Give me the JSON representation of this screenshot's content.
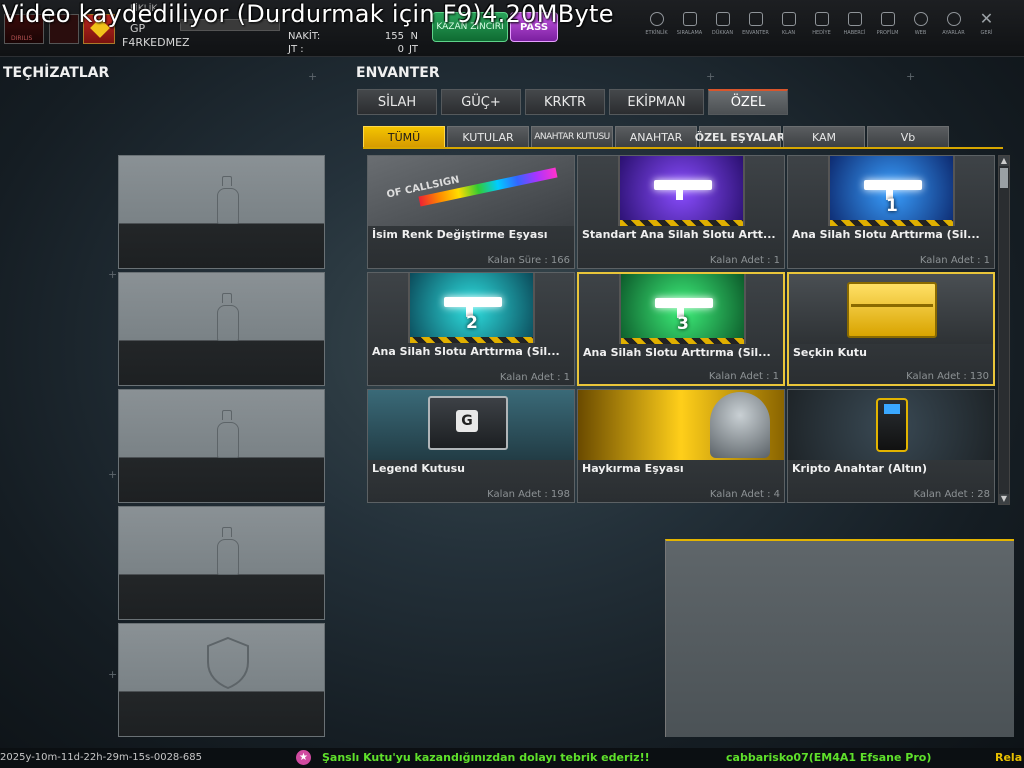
{
  "overlay_text": "Video kaydediliyor (Durdurmak için F9)4.20MByte",
  "player": {
    "name": "F4RKEDMEZ",
    "gp_label": "GP",
    "fiks_label": "FİKLİK"
  },
  "currency": [
    {
      "label": "NAKİT:",
      "value": "155",
      "unit": "N"
    },
    {
      "label": "JT   :",
      "value": "0",
      "unit": "JT"
    }
  ],
  "buttons": {
    "zincir": "KAZAN ZİNCİRİ",
    "pass": "PASS"
  },
  "nav": [
    {
      "label": "ETKİNLİK",
      "icon": "event-icon"
    },
    {
      "label": "SIRALAMA",
      "icon": "ranking-icon"
    },
    {
      "label": "DÜKKAN",
      "icon": "cart-icon"
    },
    {
      "label": "ENVANTER",
      "icon": "inventory-icon"
    },
    {
      "label": "KLAN",
      "icon": "clan-icon"
    },
    {
      "label": "HEDİYE",
      "icon": "gift-icon"
    },
    {
      "label": "HABERCİ",
      "icon": "megaphone-icon"
    },
    {
      "label": "PROFİLM",
      "icon": "profile-icon"
    },
    {
      "label": "WEB",
      "icon": "globe-icon"
    },
    {
      "label": "AYARLAR",
      "icon": "gear-icon"
    },
    {
      "label": "GERİ",
      "icon": "close-icon"
    }
  ],
  "equipment": {
    "title": "TEÇHİZATLAR"
  },
  "inventory": {
    "title": "ENVANTER",
    "main_tabs": [
      "SİLAH",
      "GÜÇ+",
      "KRKTR",
      "EKİPMAN",
      "ÖZEL"
    ],
    "active_main_tab": "ÖZEL",
    "sub_tabs": [
      "TÜMÜ",
      "KUTULAR",
      "ANAHTAR KUTUSU",
      "ANAHTAR",
      "ÖZEL EŞYALAR",
      "KAM",
      "Vb"
    ],
    "active_sub_tab": "TÜMÜ",
    "items": [
      {
        "name": "İsim Renk Değiştirme Eşyası",
        "meta": "Kalan Süre : 166"
      },
      {
        "name": "Standart Ana Silah Slotu Artt...",
        "meta": "Kalan Adet : 1"
      },
      {
        "name": "Ana Silah Slotu Arttırma (Sil...",
        "meta": "Kalan Adet : 1",
        "badge": "1"
      },
      {
        "name": "Ana Silah Slotu Arttırma (Sil...",
        "meta": "Kalan Adet : 1",
        "badge": "2"
      },
      {
        "name": "Ana Silah Slotu Arttırma (Sil...",
        "meta": "Kalan Adet : 1",
        "badge": "3"
      },
      {
        "name": "Seçkin Kutu",
        "meta": "Kalan Adet : 130"
      },
      {
        "name": "Legend Kutusu",
        "meta": "Kalan Adet : 198"
      },
      {
        "name": "Haykırma Eşyası",
        "meta": "Kalan Adet : 4"
      },
      {
        "name": "Kripto Anahtar (Altın)",
        "meta": "Kalan Adet : 28"
      }
    ],
    "callsign_text": "OF CALLSIGN"
  },
  "chat": {
    "timestamp": "2025y-10m-11d-22h-29m-15s-0028-685",
    "message": "Şanslı Kutu'yu kazandığınızdan dolayı tebrik ederiz!!",
    "user": "cabbarisko07(EM4A1 Efsane Pro)",
    "tail": "Rela"
  },
  "colors": {
    "accent_yellow": "#f4c400",
    "selected_border": "#e9c53a",
    "chat_green": "#5fe12b",
    "active_tab_line": "#d9552b"
  }
}
